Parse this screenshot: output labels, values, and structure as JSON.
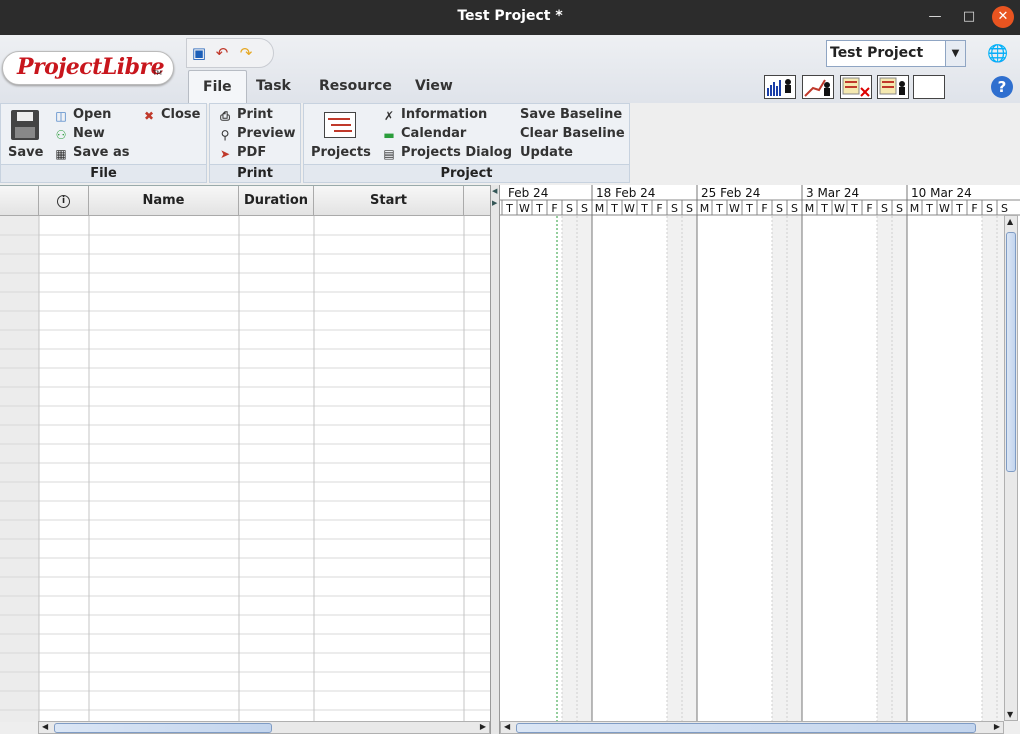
{
  "window": {
    "title": "Test Project *"
  },
  "app": {
    "logo": "ProjectLibre",
    "logo_tm": "TM"
  },
  "tabs": [
    {
      "label": "File"
    },
    {
      "label": "Task"
    },
    {
      "label": "Resource"
    },
    {
      "label": "View"
    }
  ],
  "project_select": {
    "value": "Test Project"
  },
  "ribbon": {
    "file": {
      "label": "File",
      "save": "Save",
      "open": "Open",
      "new": "New",
      "save_as": "Save as",
      "close": "Close"
    },
    "print": {
      "label": "Print",
      "print": "Print",
      "preview": "Preview",
      "pdf": "PDF"
    },
    "project": {
      "label": "Project",
      "projects": "Projects",
      "information": "Information",
      "calendar": "Calendar",
      "projects_dialog": "Projects Dialog",
      "save_baseline": "Save Baseline",
      "clear_baseline": "Clear Baseline",
      "update": "Update"
    }
  },
  "table": {
    "columns": [
      "Name",
      "Duration",
      "Start"
    ]
  },
  "gantt": {
    "weeks": [
      "Feb 24",
      "18 Feb 24",
      "25 Feb 24",
      "3 Mar 24",
      "10 Mar 24"
    ],
    "days": [
      "M",
      "T",
      "W",
      "T",
      "F",
      "S",
      "S"
    ]
  },
  "colors": {
    "accent": "#e95420",
    "help": "#2f6fcf",
    "logo": "#c8161d"
  }
}
